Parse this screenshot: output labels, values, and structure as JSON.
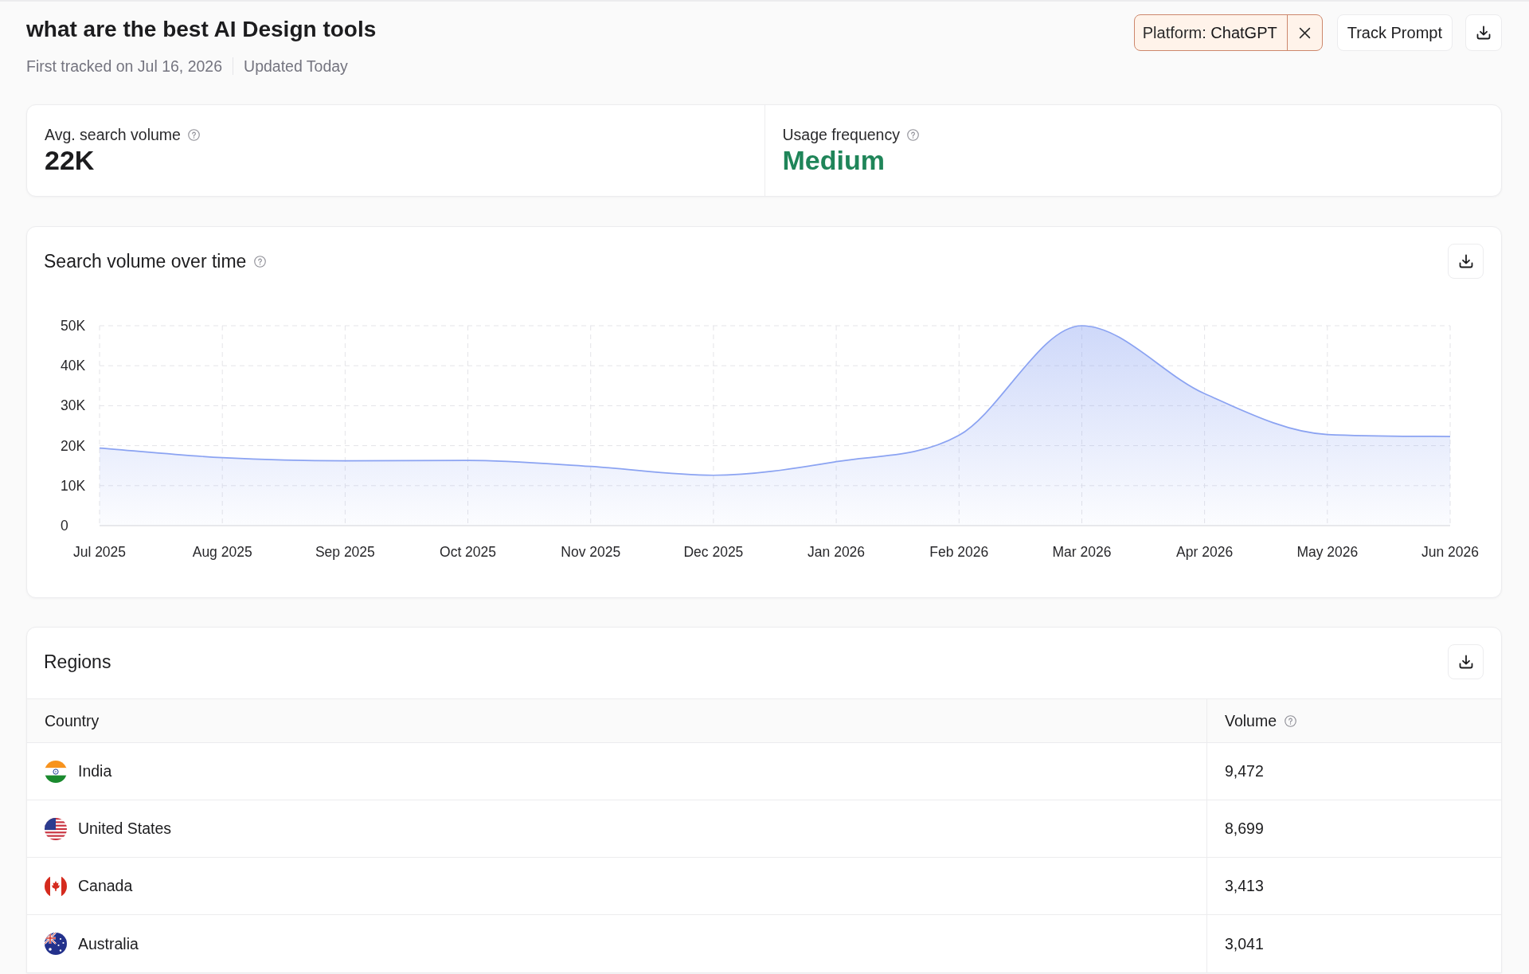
{
  "header": {
    "title": "what are the best AI Design tools",
    "first_tracked": "First tracked on Jul 16, 2026",
    "updated": "Updated Today",
    "filter": {
      "label": "Platform:",
      "value": "ChatGPT"
    },
    "track_button": "Track Prompt"
  },
  "stats": [
    {
      "label": "Avg. search volume",
      "value": "22K",
      "kind": "count"
    },
    {
      "label": "Usage frequency",
      "value": "Medium",
      "kind": "level"
    }
  ],
  "volume_chart": {
    "chart_data": [
      {
        "type": "area",
        "title": "Search volume over time",
        "categories": [
          "Jul 2025",
          "Aug 2025",
          "Sep 2025",
          "Oct 2025",
          "Nov 2025",
          "Dec 2025",
          "Jan 2026",
          "Feb 2026",
          "Mar 2026",
          "Apr 2026",
          "May 2026",
          "Jun 2026"
        ],
        "values": [
          19400,
          17000,
          16200,
          16300,
          14800,
          12600,
          16000,
          22600,
          50000,
          33000,
          22800,
          22300
        ],
        "color": "#8ba3f2",
        "ylim": [
          0,
          50000
        ],
        "yticks": [
          {
            "value": 0,
            "label": "0"
          },
          {
            "value": 10000,
            "label": "10K"
          },
          {
            "value": 20000,
            "label": "20K"
          },
          {
            "value": 30000,
            "label": "30K"
          },
          {
            "value": 40000,
            "label": "40K"
          },
          {
            "value": 50000,
            "label": "50K"
          }
        ],
        "grid": true
      }
    ]
  },
  "regions": {
    "title": "Regions",
    "columns": [
      {
        "label": "Country",
        "kind": "plain"
      },
      {
        "label": "Volume",
        "kind": "help"
      }
    ],
    "rows": [
      {
        "kind": "india",
        "country": "India",
        "volume": "9,472"
      },
      {
        "kind": "usa",
        "country": "United States",
        "volume": "8,699"
      },
      {
        "kind": "canada",
        "country": "Canada",
        "volume": "3,413"
      },
      {
        "kind": "australia",
        "country": "Australia",
        "volume": "3,041"
      }
    ]
  }
}
